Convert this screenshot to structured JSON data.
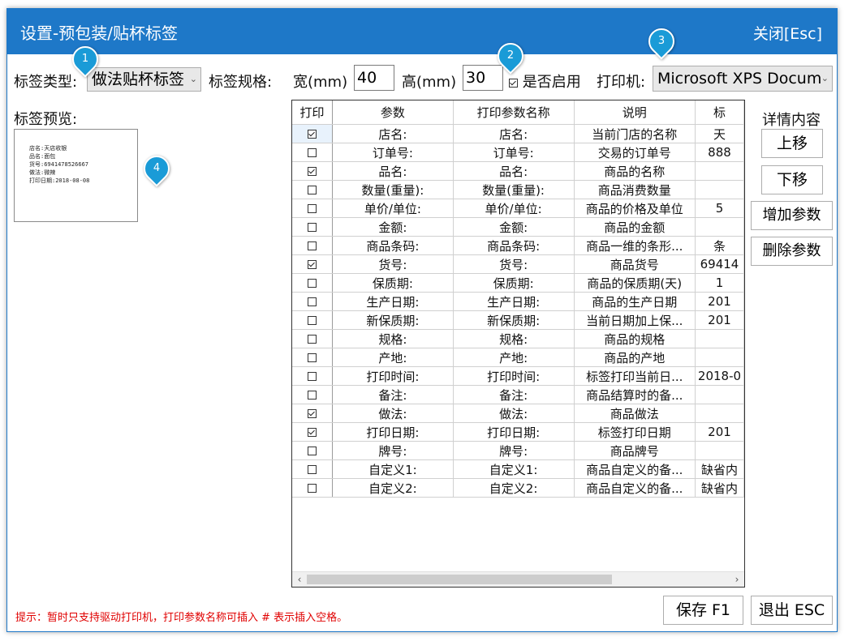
{
  "window": {
    "title": "设置-预包装/贴杯标签",
    "close_label": "关闭[Esc]"
  },
  "toolbar": {
    "label_type_label": "标签类型:",
    "label_type_value": "做法贴杯标签",
    "spec_label": "标签规格:",
    "width_label": "宽(mm)",
    "width_value": "40",
    "height_label": "高(mm)",
    "height_value": "30",
    "enabled_label": "是否启用",
    "enabled_checked": true,
    "printer_label": "打印机:",
    "printer_value": "Microsoft XPS Docum"
  },
  "preview": {
    "title": "标签预览:",
    "lines": [
      "店名:天店收银",
      "品名:面包",
      "货号:6941478526667",
      "做法:微辣",
      "打印日期:2018-08-08"
    ]
  },
  "badges": [
    "1",
    "2",
    "3",
    "4"
  ],
  "grid": {
    "columns": [
      "打印",
      "参数",
      "打印参数名称",
      "说明",
      "标"
    ],
    "rows": [
      {
        "checked": true,
        "param": "店名:",
        "name": "店名:",
        "desc": "当前门店的名称",
        "extra": "天"
      },
      {
        "checked": false,
        "param": "订单号:",
        "name": "订单号:",
        "desc": "交易的订单号",
        "extra": "888"
      },
      {
        "checked": true,
        "param": "品名:",
        "name": "品名:",
        "desc": "商品的名称",
        "extra": ""
      },
      {
        "checked": false,
        "param": "数量(重量):",
        "name": "数量(重量):",
        "desc": "商品消费数量",
        "extra": ""
      },
      {
        "checked": false,
        "param": "单价/单位:",
        "name": "单价/单位:",
        "desc": "商品的价格及单位",
        "extra": "5"
      },
      {
        "checked": false,
        "param": "金额:",
        "name": "金额:",
        "desc": "商品的金额",
        "extra": ""
      },
      {
        "checked": false,
        "param": "商品条码:",
        "name": "商品条码:",
        "desc": "商品一维的条形...",
        "extra": "条"
      },
      {
        "checked": true,
        "param": "货号:",
        "name": "货号:",
        "desc": "商品货号",
        "extra": "69414"
      },
      {
        "checked": false,
        "param": "保质期:",
        "name": "保质期:",
        "desc": "商品的保质期(天)",
        "extra": "1"
      },
      {
        "checked": false,
        "param": "生产日期:",
        "name": "生产日期:",
        "desc": "商品的生产日期",
        "extra": "201"
      },
      {
        "checked": false,
        "param": "新保质期:",
        "name": "新保质期:",
        "desc": "当前日期加上保...",
        "extra": "201"
      },
      {
        "checked": false,
        "param": "规格:",
        "name": "规格:",
        "desc": "商品的规格",
        "extra": ""
      },
      {
        "checked": false,
        "param": "产地:",
        "name": "产地:",
        "desc": "商品的产地",
        "extra": ""
      },
      {
        "checked": false,
        "param": "打印时间:",
        "name": "打印时间:",
        "desc": "标签打印当前日...",
        "extra": "2018-0"
      },
      {
        "checked": false,
        "param": "备注:",
        "name": "备注:",
        "desc": "商品结算时的备...",
        "extra": ""
      },
      {
        "checked": true,
        "param": "做法:",
        "name": "做法:",
        "desc": "商品做法",
        "extra": ""
      },
      {
        "checked": true,
        "param": "打印日期:",
        "name": "打印日期:",
        "desc": "标签打印日期",
        "extra": "201"
      },
      {
        "checked": false,
        "param": "牌号:",
        "name": "牌号:",
        "desc": "商品牌号",
        "extra": ""
      },
      {
        "checked": false,
        "param": "自定义1:",
        "name": "自定义1:",
        "desc": "商品自定义的备...",
        "extra": "缺省内"
      },
      {
        "checked": false,
        "param": "自定义2:",
        "name": "自定义2:",
        "desc": "商品自定义的备...",
        "extra": "缺省内"
      }
    ]
  },
  "side_panel": {
    "title": "详情内容",
    "move_up": "上移",
    "move_down": "下移",
    "add_param": "增加参数",
    "delete_param": "删除参数"
  },
  "footer": {
    "hint": "提示：暂时只支持驱动打印机，打印参数名称可插入 # 表示插入空格。",
    "save": "保存 F1",
    "exit": "退出 ESC"
  }
}
